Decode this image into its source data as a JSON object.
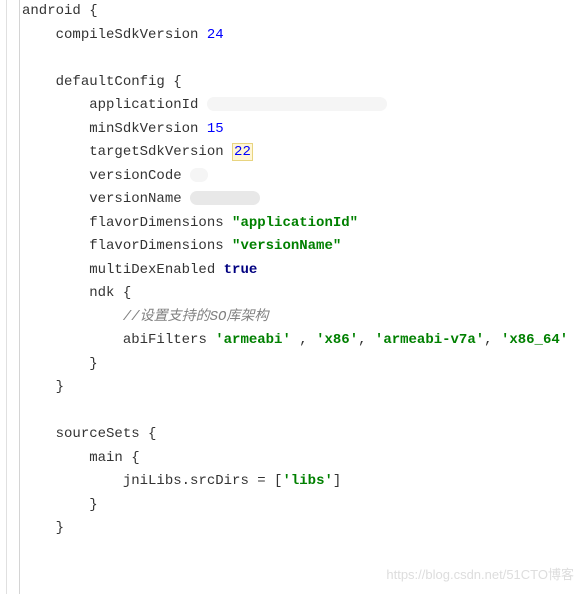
{
  "code": {
    "l1_android": "android {",
    "l2_compile": "compileSdkVersion ",
    "l2_num": "24",
    "l4_default": "defaultConfig {",
    "l5_appid": "applicationId ",
    "l6_minsdk": "minSdkVersion ",
    "l6_num": "15",
    "l7_target": "targetSdkVersion ",
    "l7_num": "22",
    "l8_vcode": "versionCode ",
    "l9_vname": "versionName ",
    "l10_flavor": "flavorDimensions ",
    "l10_str": "\"applicationId\"",
    "l11_flavor": "flavorDimensions ",
    "l11_str": "\"versionName\"",
    "l12_multi": "multiDexEnabled ",
    "l12_true": "true",
    "l13_ndk": "ndk {",
    "l14_comment": "//设置支持的SO库架构",
    "l15_abi": "abiFilters ",
    "l15_s1": "'armeabi'",
    "l15_c1": " , ",
    "l15_s2": "'x86'",
    "l15_c2": ", ",
    "l15_s3": "'armeabi-v7a'",
    "l15_c3": ", ",
    "l15_s4": "'x86_64'",
    "l16_close": "}",
    "l17_close": "}",
    "l19_source": "sourceSets {",
    "l20_main": "main {",
    "l21_jni": "jniLibs.srcDirs = [",
    "l21_libs": "'libs'",
    "l21_close": "]",
    "l22_close": "}",
    "l23_close": "}"
  },
  "watermark": "https://blog.csdn.net/51CTO博客"
}
